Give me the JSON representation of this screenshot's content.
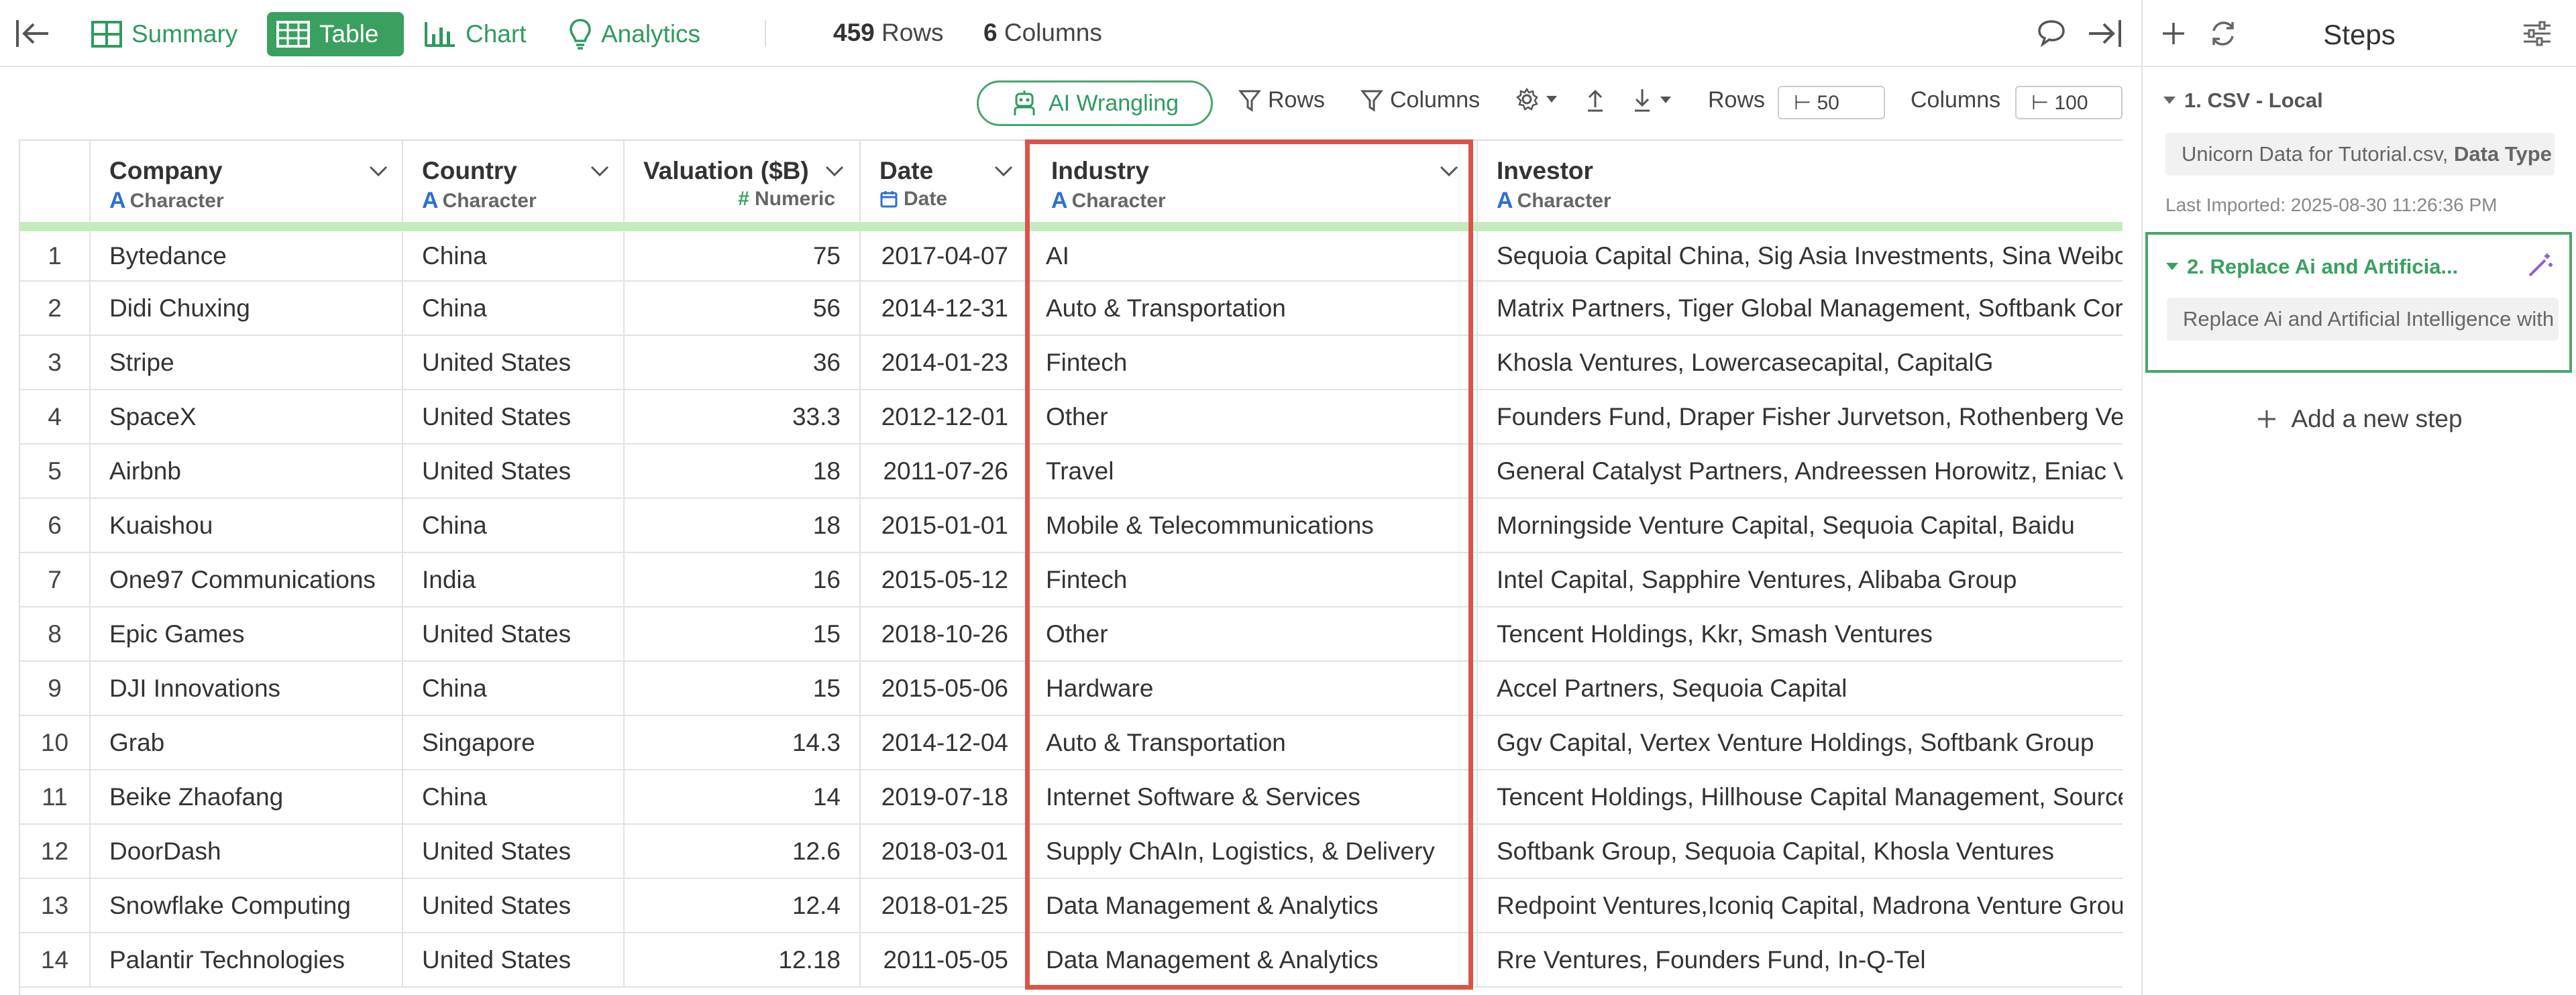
{
  "topbar": {
    "views": [
      {
        "label": "Summary",
        "active": false
      },
      {
        "label": "Table",
        "active": true
      },
      {
        "label": "Chart",
        "active": false
      },
      {
        "label": "Analytics",
        "active": false
      }
    ],
    "rows_count": "459",
    "rows_label": "Rows",
    "cols_count": "6",
    "cols_label": "Columns"
  },
  "toolbar": {
    "ai_label": "AI Wrangling",
    "rows_filter": "Rows",
    "columns_filter": "Columns",
    "rows_label": "Rows",
    "rows_value": "⊢ 50",
    "columns_label": "Columns",
    "columns_value": "⊢ 100"
  },
  "columns": [
    {
      "name": "Company",
      "type": "Character"
    },
    {
      "name": "Country",
      "type": "Character"
    },
    {
      "name": "Valuation ($B)",
      "type": "Numeric"
    },
    {
      "name": "Date",
      "type": "Date"
    },
    {
      "name": "Industry",
      "type": "Character"
    },
    {
      "name": "Investor",
      "type": "Character"
    }
  ],
  "rows": [
    [
      "1",
      "Bytedance",
      "China",
      "75",
      "2017-04-07",
      "AI",
      "Sequoia Capital China, Sig Asia Investments, Sina Weibo, Softbank Group"
    ],
    [
      "2",
      "Didi Chuxing",
      "China",
      "56",
      "2014-12-31",
      "Auto & Transportation",
      "Matrix Partners, Tiger Global Management, Softbank Corp."
    ],
    [
      "3",
      "Stripe",
      "United States",
      "36",
      "2014-01-23",
      "Fintech",
      "Khosla Ventures, Lowercasecapital, CapitalG"
    ],
    [
      "4",
      "SpaceX",
      "United States",
      "33.3",
      "2012-12-01",
      "Other",
      "Founders Fund, Draper Fisher Jurvetson, Rothenberg Ventures"
    ],
    [
      "5",
      "Airbnb",
      "United States",
      "18",
      "2011-07-26",
      "Travel",
      "General Catalyst Partners, Andreessen Horowitz, Eniac Ventures"
    ],
    [
      "6",
      "Kuaishou",
      "China",
      "18",
      "2015-01-01",
      "Mobile & Telecommunications",
      "Morningside Venture Capital, Sequoia Capital, Baidu"
    ],
    [
      "7",
      "One97 Communications",
      "India",
      "16",
      "2015-05-12",
      "Fintech",
      "Intel Capital, Sapphire Ventures, Alibaba Group"
    ],
    [
      "8",
      "Epic Games",
      "United States",
      "15",
      "2018-10-26",
      "Other",
      "Tencent Holdings, Kkr, Smash Ventures"
    ],
    [
      "9",
      "DJI Innovations",
      "China",
      "15",
      "2015-05-06",
      "Hardware",
      "Accel Partners, Sequoia Capital"
    ],
    [
      "10",
      "Grab",
      "Singapore",
      "14.3",
      "2014-12-04",
      "Auto & Transportation",
      "Ggv Capital, Vertex Venture Holdings, Softbank Group"
    ],
    [
      "11",
      "Beike Zhaofang",
      "China",
      "14",
      "2019-07-18",
      "Internet Software & Services",
      "Tencent Holdings, Hillhouse Capital Management, Source Code Capital"
    ],
    [
      "12",
      "DoorDash",
      "United States",
      "12.6",
      "2018-03-01",
      "Supply ChAIn, Logistics, & Delivery",
      "Softbank Group, Sequoia Capital, Khosla Ventures"
    ],
    [
      "13",
      "Snowflake Computing",
      "United States",
      "12.4",
      "2018-01-25",
      "Data Management & Analytics",
      "Redpoint Ventures,Iconiq Capital, Madrona Venture Group"
    ],
    [
      "14",
      "Palantir Technologies",
      "United States",
      "12.18",
      "2011-05-05",
      "Data Management & Analytics",
      "Rre Ventures, Founders Fund, In-Q-Tel"
    ]
  ],
  "panel": {
    "title": "Steps",
    "step1": {
      "title": "1. CSV - Local",
      "file": "Unicorn Data for Tutorial.csv,",
      "file_bold": "Data Type",
      "meta": "Last Imported: 2025-08-30 11:26:36 PM"
    },
    "step2": {
      "title": "2. Replace Ai and Artificia...",
      "desc": "Replace Ai and Artificial Intelligence with AI"
    },
    "add_step": "Add a new step"
  },
  "colors": {
    "accent_green": "#3aa060",
    "highlight_red": "#d9554a",
    "header_strip": "#c5ecbf",
    "type_blue": "#2c6fd1"
  }
}
